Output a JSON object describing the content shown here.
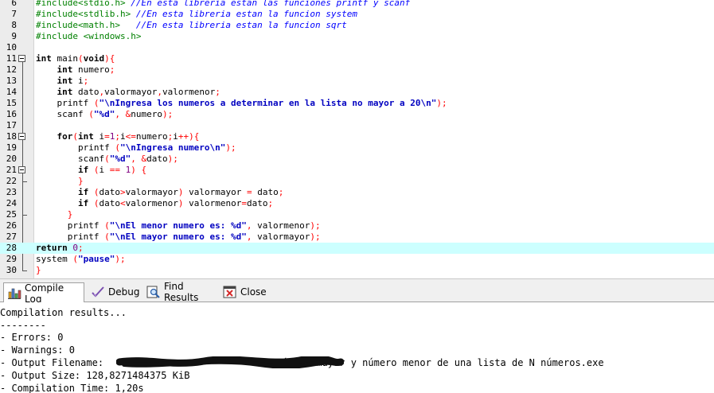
{
  "editor": {
    "lines": [
      {
        "n": "6",
        "segs": [
          {
            "t": "#include<stdio.h> ",
            "c": "pp"
          },
          {
            "t": "//En esta libreria estan las funciones printf y scanf",
            "c": "cm"
          }
        ]
      },
      {
        "n": "7",
        "segs": [
          {
            "t": "#include<stdlib.h> ",
            "c": "pp"
          },
          {
            "t": "//En esta libreria estan la funcion system",
            "c": "cm"
          }
        ]
      },
      {
        "n": "8",
        "segs": [
          {
            "t": "#include<math.h>   ",
            "c": "pp"
          },
          {
            "t": "//En esta libreria estan la funcion sqrt",
            "c": "cm"
          }
        ]
      },
      {
        "n": "9",
        "segs": [
          {
            "t": "#include <windows.h>",
            "c": "pp"
          }
        ]
      },
      {
        "n": "10",
        "segs": []
      },
      {
        "n": "11",
        "segs": [
          {
            "t": "int",
            "c": "kw"
          },
          {
            "t": " main",
            "c": ""
          },
          {
            "t": "(",
            "c": "sym"
          },
          {
            "t": "void",
            "c": "kw"
          },
          {
            "t": "){",
            "c": "sym"
          }
        ]
      },
      {
        "n": "12",
        "segs": [
          {
            "t": "    ",
            "c": ""
          },
          {
            "t": "int",
            "c": "kw"
          },
          {
            "t": " numero",
            "c": ""
          },
          {
            "t": ";",
            "c": "sym"
          }
        ]
      },
      {
        "n": "13",
        "segs": [
          {
            "t": "    ",
            "c": ""
          },
          {
            "t": "int",
            "c": "kw"
          },
          {
            "t": " i",
            "c": ""
          },
          {
            "t": ";",
            "c": "sym"
          }
        ]
      },
      {
        "n": "14",
        "segs": [
          {
            "t": "    ",
            "c": ""
          },
          {
            "t": "int",
            "c": "kw"
          },
          {
            "t": " dato",
            "c": ""
          },
          {
            "t": ",",
            "c": "sym"
          },
          {
            "t": "valormayor",
            "c": ""
          },
          {
            "t": ",",
            "c": "sym"
          },
          {
            "t": "valormenor",
            "c": ""
          },
          {
            "t": ";",
            "c": "sym"
          }
        ]
      },
      {
        "n": "15",
        "segs": [
          {
            "t": "    printf ",
            "c": ""
          },
          {
            "t": "(",
            "c": "sym"
          },
          {
            "t": "\"\\nIngresa los numeros a determinar en la lista no mayor a 20\\n\"",
            "c": "str"
          },
          {
            "t": ");",
            "c": "sym"
          }
        ]
      },
      {
        "n": "16",
        "segs": [
          {
            "t": "    scanf ",
            "c": ""
          },
          {
            "t": "(",
            "c": "sym"
          },
          {
            "t": "\"%d\"",
            "c": "str"
          },
          {
            "t": ", ",
            "c": "sym"
          },
          {
            "t": "&",
            "c": "sym"
          },
          {
            "t": "numero",
            "c": ""
          },
          {
            "t": ");",
            "c": "sym"
          }
        ]
      },
      {
        "n": "17",
        "segs": []
      },
      {
        "n": "18",
        "segs": [
          {
            "t": "    ",
            "c": ""
          },
          {
            "t": "for",
            "c": "kw"
          },
          {
            "t": "(",
            "c": "sym"
          },
          {
            "t": "int",
            "c": "kw"
          },
          {
            "t": " i",
            "c": ""
          },
          {
            "t": "=",
            "c": "sym"
          },
          {
            "t": "1",
            "c": "num"
          },
          {
            "t": ";",
            "c": "sym"
          },
          {
            "t": "i",
            "c": ""
          },
          {
            "t": "<=",
            "c": "sym"
          },
          {
            "t": "numero",
            "c": ""
          },
          {
            "t": ";",
            "c": "sym"
          },
          {
            "t": "i",
            "c": ""
          },
          {
            "t": "++){",
            "c": "sym"
          }
        ]
      },
      {
        "n": "19",
        "segs": [
          {
            "t": "        printf ",
            "c": ""
          },
          {
            "t": "(",
            "c": "sym"
          },
          {
            "t": "\"\\nIngresa numero\\n\"",
            "c": "str"
          },
          {
            "t": ");",
            "c": "sym"
          }
        ]
      },
      {
        "n": "20",
        "segs": [
          {
            "t": "        scanf",
            "c": ""
          },
          {
            "t": "(",
            "c": "sym"
          },
          {
            "t": "\"%d\"",
            "c": "str"
          },
          {
            "t": ", ",
            "c": "sym"
          },
          {
            "t": "&",
            "c": "sym"
          },
          {
            "t": "dato",
            "c": ""
          },
          {
            "t": ");",
            "c": "sym"
          }
        ]
      },
      {
        "n": "21",
        "segs": [
          {
            "t": "        ",
            "c": ""
          },
          {
            "t": "if",
            "c": "kw"
          },
          {
            "t": " ",
            "c": ""
          },
          {
            "t": "(",
            "c": "sym"
          },
          {
            "t": "i ",
            "c": ""
          },
          {
            "t": "==",
            "c": "sym"
          },
          {
            "t": " ",
            "c": ""
          },
          {
            "t": "1",
            "c": "num"
          },
          {
            "t": ")",
            "c": "sym"
          },
          {
            "t": " ",
            "c": ""
          },
          {
            "t": "{",
            "c": "sym"
          }
        ]
      },
      {
        "n": "22",
        "segs": [
          {
            "t": "        ",
            "c": ""
          },
          {
            "t": "}",
            "c": "sym"
          }
        ]
      },
      {
        "n": "23",
        "segs": [
          {
            "t": "        ",
            "c": ""
          },
          {
            "t": "if",
            "c": "kw"
          },
          {
            "t": " ",
            "c": ""
          },
          {
            "t": "(",
            "c": "sym"
          },
          {
            "t": "dato",
            "c": ""
          },
          {
            "t": ">",
            "c": "sym"
          },
          {
            "t": "valormayor",
            "c": ""
          },
          {
            "t": ")",
            "c": "sym"
          },
          {
            "t": " valormayor ",
            "c": ""
          },
          {
            "t": "=",
            "c": "sym"
          },
          {
            "t": " dato",
            "c": ""
          },
          {
            "t": ";",
            "c": "sym"
          }
        ]
      },
      {
        "n": "24",
        "segs": [
          {
            "t": "        ",
            "c": ""
          },
          {
            "t": "if",
            "c": "kw"
          },
          {
            "t": " ",
            "c": ""
          },
          {
            "t": "(",
            "c": "sym"
          },
          {
            "t": "dato",
            "c": ""
          },
          {
            "t": "<",
            "c": "sym"
          },
          {
            "t": "valormenor",
            "c": ""
          },
          {
            "t": ")",
            "c": "sym"
          },
          {
            "t": " valormenor",
            "c": ""
          },
          {
            "t": "=",
            "c": "sym"
          },
          {
            "t": "dato",
            "c": ""
          },
          {
            "t": ";",
            "c": "sym"
          }
        ]
      },
      {
        "n": "25",
        "segs": [
          {
            "t": "      ",
            "c": ""
          },
          {
            "t": "}",
            "c": "sym"
          }
        ]
      },
      {
        "n": "26",
        "segs": [
          {
            "t": "      printf ",
            "c": ""
          },
          {
            "t": "(",
            "c": "sym"
          },
          {
            "t": "\"\\nEl menor numero es: %d\"",
            "c": "str"
          },
          {
            "t": ", ",
            "c": "sym"
          },
          {
            "t": "valormenor",
            "c": ""
          },
          {
            "t": ");",
            "c": "sym"
          }
        ]
      },
      {
        "n": "27",
        "segs": [
          {
            "t": "      printf ",
            "c": ""
          },
          {
            "t": "(",
            "c": "sym"
          },
          {
            "t": "\"\\nEl mayor numero es: %d\"",
            "c": "str"
          },
          {
            "t": ", ",
            "c": "sym"
          },
          {
            "t": "valormayor",
            "c": ""
          },
          {
            "t": ");",
            "c": "sym"
          }
        ]
      },
      {
        "n": "28",
        "segs": [
          {
            "t": "return",
            "c": "kw"
          },
          {
            "t": " ",
            "c": ""
          },
          {
            "t": "0",
            "c": "num"
          },
          {
            "t": ";",
            "c": "sym"
          }
        ],
        "current": true
      },
      {
        "n": "29",
        "segs": [
          {
            "t": "system ",
            "c": ""
          },
          {
            "t": "(",
            "c": "sym"
          },
          {
            "t": "\"pause\"",
            "c": "str"
          },
          {
            "t": ");",
            "c": "sym"
          }
        ]
      },
      {
        "n": "30",
        "segs": [
          {
            "t": "}",
            "c": "sym"
          }
        ]
      }
    ]
  },
  "tabs": [
    {
      "label": "Compile Log",
      "icon": "bar-chart-icon",
      "active": true
    },
    {
      "label": "Debug",
      "icon": "check-icon",
      "active": false
    },
    {
      "label": "Find Results",
      "icon": "find-icon",
      "active": false
    },
    {
      "label": "Close",
      "icon": "close-icon",
      "active": false
    }
  ],
  "log": {
    "lines": [
      "Compilation results...",
      "--------",
      "- Errors: 0",
      "- Warnings: 0",
      "- Output Filename:                              Número mayor y número menor de una lista de N números.exe",
      "- Output Size: 128,8271484375 KiB",
      "- Compilation Time: 1,20s"
    ]
  },
  "colors": {
    "current_line": "#ccffff",
    "string": "#0000c0",
    "comment": "#0000ff",
    "preprocessor": "#008000",
    "symbol": "#ff0000",
    "number": "#800080"
  }
}
